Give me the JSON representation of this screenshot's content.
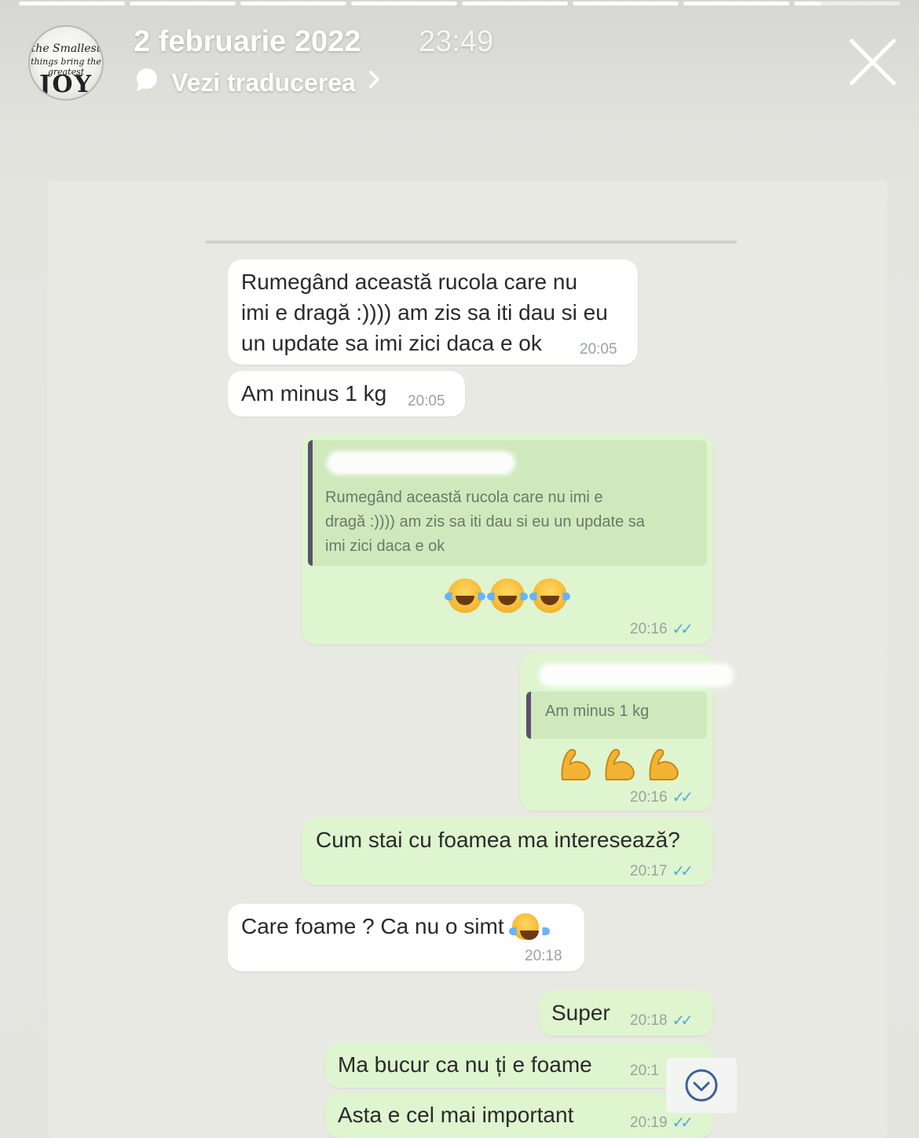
{
  "story": {
    "date": "2 februarie 2022",
    "time": "23:49",
    "translate_label": "Vezi traducerea",
    "progress": [
      1,
      1,
      1,
      1,
      1,
      1,
      1,
      0.25
    ],
    "avatar_text": [
      "the Smallest",
      "things bring the greatest",
      "JOY"
    ]
  },
  "chat": {
    "messages": [
      {
        "type": "in",
        "text_lines": [
          "Rumegând această rucola care nu",
          "imi e dragă :)))) am zis sa iti dau si eu",
          "un update sa imi zici daca e ok"
        ],
        "time": "20:05"
      },
      {
        "type": "in",
        "text": "Am minus 1 kg",
        "time": "20:05"
      },
      {
        "type": "out",
        "quote_lines": [
          "Rumegând această rucola care nu imi e",
          "dragă :)))) am zis sa iti dau si eu un update sa",
          "imi zici daca e ok"
        ],
        "emoji": "laughing-emoji",
        "time": "20:16"
      },
      {
        "type": "out",
        "quote": "Am minus 1 kg",
        "emoji": "flexed-biceps-emoji",
        "time": "20:16"
      },
      {
        "type": "out",
        "text": "Cum stai cu foamea ma interesează?",
        "time": "20:17"
      },
      {
        "type": "in",
        "text": "Care foame ? Ca nu o simt",
        "time": "20:18"
      },
      {
        "type": "out",
        "text": "Super",
        "time": "20:18"
      },
      {
        "type": "out",
        "text": "Ma bucur ca nu ți e foame",
        "time": "20:1"
      },
      {
        "type": "out",
        "text": "Asta e cel mai important",
        "time": "20:19"
      }
    ]
  },
  "colors": {
    "incoming_bubble": "#ffffff",
    "outgoing_bubble": "#def5cf",
    "quote_bar": "#5c4f6e",
    "read_ticks": "#5aa9d8"
  },
  "icons": [
    "close-icon",
    "chat-bubble-icon",
    "chevron-right-icon",
    "scroll-down-icon"
  ]
}
